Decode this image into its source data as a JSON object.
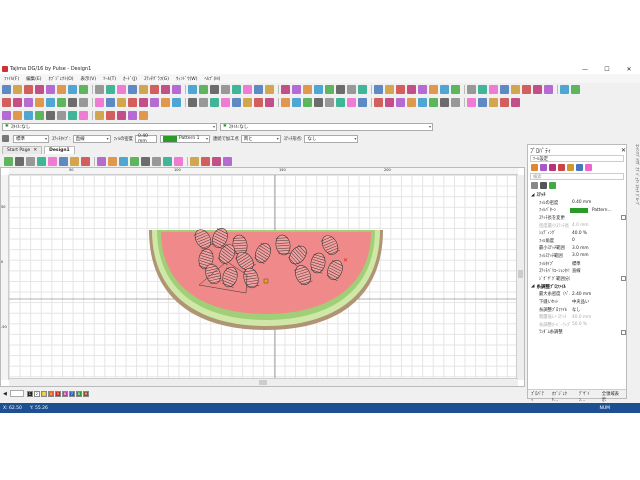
{
  "window": {
    "title": "Tajima DG/16 by Pulse - Design1",
    "minimize": "—",
    "maximize": "☐",
    "close": "✕"
  },
  "menu": [
    "ﾌｧｲﾙ(F)",
    "編集(E)",
    "ｵﾌﾞｼﾞｪｸﾄ(O)",
    "表示(V)",
    "ﾂｰﾙ(T)",
    "ｶｰﾄﾞ(J)",
    "ｽﾃｯﾁｸﾞﾗﾌ(G)",
    "ｳｨﾝﾄﾞｳ(W)",
    "ﾍﾙﾌﾟ(H)"
  ],
  "style_bar": {
    "combo1": "ｽﾀｲﾙ:なし",
    "combo2": "ｽﾀｲﾙ:なし"
  },
  "prop_row": {
    "combo_std": "標準",
    "stitch_type_label": "ｽﾃｯﾁﾀｲﾌﾟ:",
    "stitch_type_value": "直線",
    "fill_spacing_label": "ﾌｨﾙの密度",
    "fill_spacing_value": "0.40 mm",
    "pattern_value": "Pattern 1",
    "rotate_label": "連続で加工点",
    "rotate_value": "両と",
    "stitch_pos_label": "ｽﾃｯﾁ形点:",
    "stitch_pos_value": "なし"
  },
  "tabs": [
    "Start Page",
    "Design1"
  ],
  "colors": {
    "melon_flesh": "#f08a8a",
    "rind_light": "#cfe8a8",
    "rind_dark": "#a0cf78",
    "rind_outer": "#b09575",
    "status_bar": "#1d4f93",
    "selected_color": "#2a9a2a"
  },
  "panel": {
    "title": "ﾌﾟﾛﾊﾟﾃｨ",
    "subtitle": "ﾂｰﾙ設定",
    "search_placeholder": "検索",
    "section1": "ｽﾃｯﾁ",
    "props1": [
      {
        "k": "ﾌｨﾙの密度",
        "v": "0.40 mm"
      },
      {
        "k": "ﾌｨﾙﾊﾟﾀｰﾝ",
        "v": "Pattern..."
      },
      {
        "k": "ｽﾃｯﾁ長を変更",
        "v": ""
      },
      {
        "k": "密度最小ｽﾃｯﾁ長",
        "v": "4.0 mm"
      },
      {
        "k": "ｼｮﾃﾞｨﾝｸﾞ",
        "v": "40.0 %"
      },
      {
        "k": "ﾌｨﾙ角度",
        "v": "0"
      },
      {
        "k": "最小ｽﾃｯﾁ範囲",
        "v": "3.0 mm"
      },
      {
        "k": "ﾌｨﾙｽﾃｯﾁ範囲",
        "v": "3.0 mm"
      },
      {
        "k": "ﾌｨﾙﾀｲﾌﾟ",
        "v": "標準"
      },
      {
        "k": "ｽﾃｯﾁﾊﾞﾘｴｰｼｮﾝﾀｲﾌﾟ",
        "v": "直線"
      },
      {
        "k": "ｼﾞｸﾞｻﾞｸﾞ範囲分割...",
        "v": ""
      }
    ],
    "section2": "糸調整ﾌﾟﾛﾌｧｲﾙ",
    "props2": [
      {
        "k": "最大糸密度（ﾍﾟ...",
        "v": "2.40 mm"
      },
      {
        "k": "下縫いｾｯﾄ",
        "v": "中央品い"
      },
      {
        "k": "糸調整ﾌﾟﾛﾌｧｲﾙ",
        "v": "なし"
      },
      {
        "k": "階層低い-ｽﾃｯﾁ",
        "v": "40.0 mm"
      },
      {
        "k": "糸調整ｵｰﾊﾞｰﾗｯﾌﾟ",
        "v": "50.0 %"
      },
      {
        "k": "ﾗﾝﾀﾞﾑ糸調整",
        "v": ""
      }
    ],
    "bottom_tabs": [
      "ﾌﾟﾛﾊﾟﾃｨ",
      "ｵﾌﾞｼﾞｪｸﾄ...",
      "ﾃﾞｻﾞｲﾝ...",
      "全領域表示"
    ]
  },
  "right_strip": "ｺﾝﾃﾝﾂﾌﾞﾗｳｻﾞ  ｵﾌﾞｼﾞｪｸﾄ  ｽﾃｯﾁ  ｸﾞﾙｰﾌﾟ",
  "ruler_top": [
    "50",
    "100",
    "150",
    "200"
  ],
  "ruler_left": [
    "50",
    "0",
    "-50"
  ],
  "status": {
    "x": "X: 62.50",
    "y": "Y: 55.26",
    "num": "NUM"
  },
  "swatch_labels": [
    "1",
    "2",
    "3",
    "4",
    "5",
    "6",
    "7",
    "8",
    "9"
  ]
}
